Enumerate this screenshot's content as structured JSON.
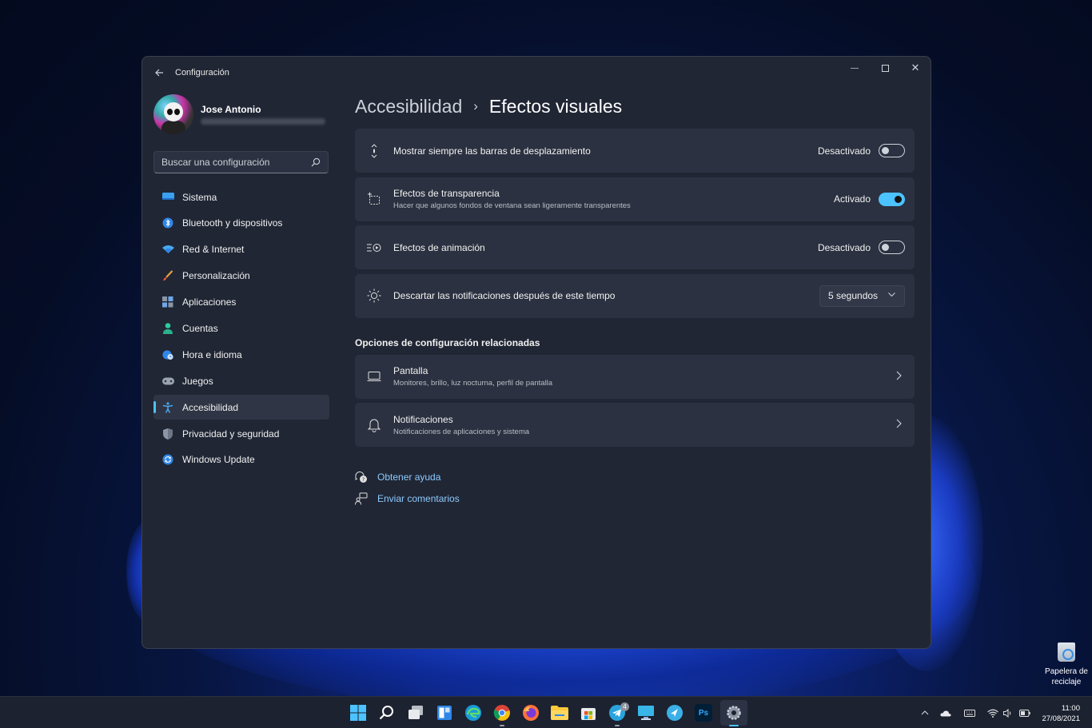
{
  "window": {
    "app_title": "Configuración",
    "minimize": "—",
    "close": "✕"
  },
  "user": {
    "name": "Jose Antonio"
  },
  "search": {
    "placeholder": "Buscar una configuración"
  },
  "sidebar": {
    "items": [
      {
        "label": "Sistema",
        "icon": "monitor-icon"
      },
      {
        "label": "Bluetooth y dispositivos",
        "icon": "bluetooth-icon"
      },
      {
        "label": "Red & Internet",
        "icon": "wifi-icon"
      },
      {
        "label": "Personalización",
        "icon": "brush-icon"
      },
      {
        "label": "Aplicaciones",
        "icon": "apps-icon"
      },
      {
        "label": "Cuentas",
        "icon": "person-icon"
      },
      {
        "label": "Hora e idioma",
        "icon": "globe-clock-icon"
      },
      {
        "label": "Juegos",
        "icon": "gamepad-icon"
      },
      {
        "label": "Accesibilidad",
        "icon": "accessibility-icon",
        "active": true
      },
      {
        "label": "Privacidad y seguridad",
        "icon": "shield-icon"
      },
      {
        "label": "Windows Update",
        "icon": "update-icon"
      }
    ]
  },
  "breadcrumb": {
    "parent": "Accesibilidad",
    "separator": "›",
    "current": "Efectos visuales"
  },
  "settings": [
    {
      "title": "Mostrar siempre las barras de desplazamiento",
      "state": "Desactivado",
      "on": false,
      "icon": "scrollbar-icon"
    },
    {
      "title": "Efectos de transparencia",
      "subtitle": "Hacer que algunos fondos de ventana sean ligeramente transparentes",
      "state": "Activado",
      "on": true,
      "icon": "transparency-icon"
    },
    {
      "title": "Efectos de animación",
      "state": "Desactivado",
      "on": false,
      "icon": "animation-icon"
    },
    {
      "title": "Descartar las notificaciones después de este tiempo",
      "dropdown_value": "5 segundos",
      "icon": "brightness-icon"
    }
  ],
  "related": {
    "heading": "Opciones de configuración relacionadas",
    "items": [
      {
        "title": "Pantalla",
        "subtitle": "Monitores, brillo, luz nocturna, perfil de pantalla",
        "icon": "display-icon"
      },
      {
        "title": "Notificaciones",
        "subtitle": "Notificaciones de aplicaciones y sistema",
        "icon": "bell-icon"
      }
    ]
  },
  "links": {
    "help": "Obtener ayuda",
    "feedback": "Enviar comentarios"
  },
  "desktop": {
    "recycle_bin_line1": "Papelera de",
    "recycle_bin_line2": "reciclaje"
  },
  "taskbar": {
    "ps_label": "Ps",
    "telegram_badge": "4",
    "time": "11:00",
    "date": "27/08/2021"
  },
  "colors": {
    "accent": "#4cc2ff",
    "link": "#8ecaff",
    "window_bg": "#202634",
    "card_bg": "#2b3140"
  }
}
